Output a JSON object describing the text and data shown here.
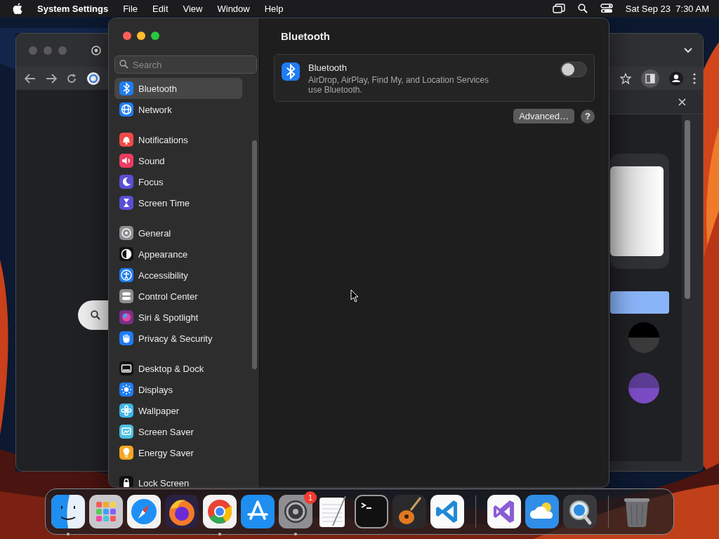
{
  "menu_bar": {
    "app_name": "System Settings",
    "menus": [
      "File",
      "Edit",
      "View",
      "Window",
      "Help"
    ],
    "clock": "Sat Sep 23  7:30 AM"
  },
  "settings_window": {
    "search": {
      "placeholder": "Search"
    },
    "sidebar": {
      "groups": [
        [
          {
            "label": "Bluetooth",
            "kind": "bluetooth",
            "color": "#1f7cf4",
            "selected": true
          },
          {
            "label": "Network",
            "kind": "globe",
            "color": "#1f7cf4",
            "selected": false
          }
        ],
        [
          {
            "label": "Notifications",
            "kind": "bell",
            "color": "#ef4b46",
            "selected": false
          },
          {
            "label": "Sound",
            "kind": "speaker",
            "color": "#ec3c62",
            "selected": false
          },
          {
            "label": "Focus",
            "kind": "moon",
            "color": "#5a4fd6",
            "selected": false
          },
          {
            "label": "Screen Time",
            "kind": "hourglass",
            "color": "#5a4fd6",
            "selected": false
          }
        ],
        [
          {
            "label": "General",
            "kind": "gear",
            "color": "#8e8e93",
            "selected": false
          },
          {
            "label": "Appearance",
            "kind": "contrast",
            "color": "#111111",
            "selected": false
          },
          {
            "label": "Accessibility",
            "kind": "person",
            "color": "#1f7cf4",
            "selected": false
          },
          {
            "label": "Control Center",
            "kind": "toggles",
            "color": "#8e8e93",
            "selected": false
          },
          {
            "label": "Siri & Spotlight",
            "kind": "orb",
            "color": "#7a2f86",
            "selected": false
          },
          {
            "label": "Privacy & Security",
            "kind": "hand",
            "color": "#1f7cf4",
            "selected": false
          }
        ],
        [
          {
            "label": "Desktop & Dock",
            "kind": "dock",
            "color": "#111111",
            "selected": false
          },
          {
            "label": "Displays",
            "kind": "sun",
            "color": "#1f7cf4",
            "selected": false
          },
          {
            "label": "Wallpaper",
            "kind": "flower",
            "color": "#3fb6e8",
            "selected": false
          },
          {
            "label": "Screen Saver",
            "kind": "screen",
            "color": "#4cc1e0",
            "selected": false
          },
          {
            "label": "Energy Saver",
            "kind": "bulb",
            "color": "#f6a623",
            "selected": false
          }
        ],
        [
          {
            "label": "Lock Screen",
            "kind": "lock",
            "color": "#111111",
            "selected": false
          }
        ]
      ]
    },
    "page": {
      "title": "Bluetooth",
      "card": {
        "title": "Bluetooth",
        "description": "AirDrop, AirPlay, Find My, and Location Services\nuse Bluetooth.",
        "on": false
      },
      "buttons": [
        "Advanced…",
        "?"
      ]
    }
  },
  "dock": {
    "sections": [
      [
        {
          "kind": "finder",
          "running": true
        },
        {
          "kind": "launchpad",
          "running": false
        },
        {
          "kind": "safari",
          "running": false
        },
        {
          "kind": "firefox",
          "running": false
        },
        {
          "kind": "chrome",
          "running": true
        },
        {
          "kind": "appstore",
          "running": false
        },
        {
          "kind": "settings",
          "running": true,
          "badge": "1"
        },
        {
          "kind": "textedit",
          "running": false
        },
        {
          "kind": "terminal",
          "running": false
        },
        {
          "kind": "guitar",
          "running": false
        },
        {
          "kind": "vscode",
          "running": false
        }
      ],
      [
        {
          "kind": "vstudio",
          "running": false
        },
        {
          "kind": "weather",
          "running": false
        },
        {
          "kind": "quicktime",
          "running": false
        }
      ],
      [
        {
          "kind": "trash",
          "running": false
        }
      ]
    ]
  }
}
